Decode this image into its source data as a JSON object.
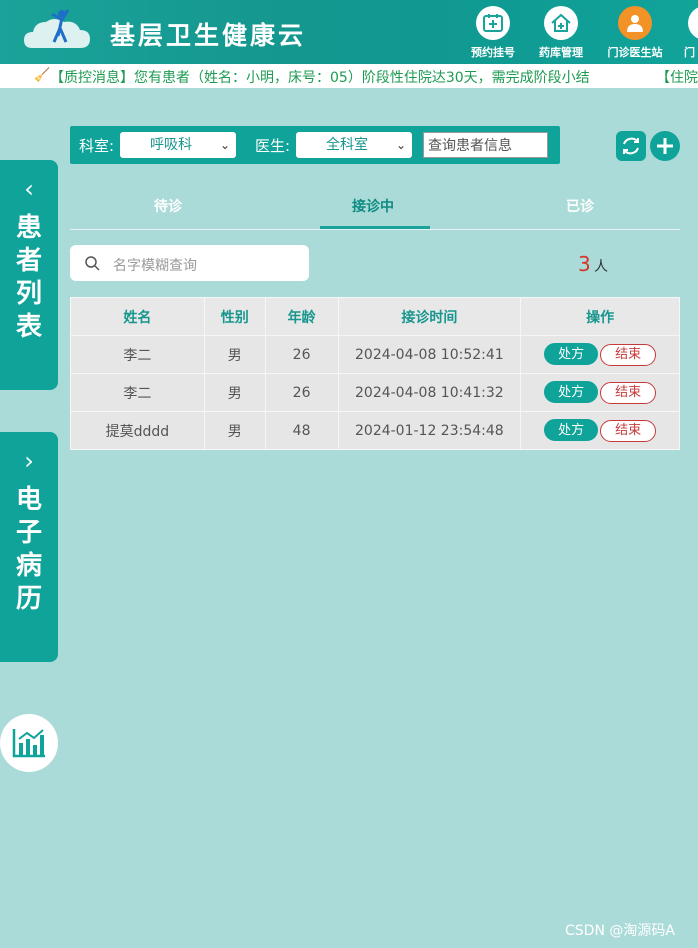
{
  "header": {
    "title": "基层卫生健康云",
    "nav": [
      {
        "label": "预约挂号",
        "icon": "appointment-icon"
      },
      {
        "label": "药库管理",
        "icon": "pharmacy-house-icon"
      },
      {
        "label": "门诊医生站",
        "icon": "doctor-icon"
      },
      {
        "label": "门",
        "icon": "clinic-icon"
      }
    ]
  },
  "marquee": {
    "text": "【质控消息】您有患者（姓名：小明，床号：05）阶段性住院达30天，需完成阶段小结",
    "text2": "【住院"
  },
  "filters": {
    "dept_label": "科室:",
    "dept_value": "呼吸科",
    "doctor_label": "医生:",
    "doctor_value": "全科室",
    "patient_placeholder": "查询患者信息"
  },
  "tabs": [
    {
      "label": "待诊",
      "active": false
    },
    {
      "label": "接诊中",
      "active": true
    },
    {
      "label": "已诊",
      "active": false
    }
  ],
  "search": {
    "placeholder": "名字模糊查询"
  },
  "count": {
    "value": "3",
    "unit": "人"
  },
  "table": {
    "headers": [
      "姓名",
      "性别",
      "年龄",
      "接诊时间",
      "操作"
    ],
    "rows": [
      {
        "name": "李二",
        "gender": "男",
        "age": "26",
        "time": "2024-04-08 10:52:41"
      },
      {
        "name": "李二",
        "gender": "男",
        "age": "26",
        "time": "2024-04-08 10:41:32"
      },
      {
        "name": "提莫dddd",
        "gender": "男",
        "age": "48",
        "time": "2024-01-12 23:54:48"
      }
    ],
    "rx_label": "处方",
    "end_label": "结束"
  },
  "side": {
    "patient_list": "患者列表",
    "emr": "电子病历"
  },
  "watermark": "CSDN @淘源码A",
  "colors": {
    "primary": "#0fa399",
    "background": "#aadbd8",
    "count_red": "#d9322a"
  }
}
